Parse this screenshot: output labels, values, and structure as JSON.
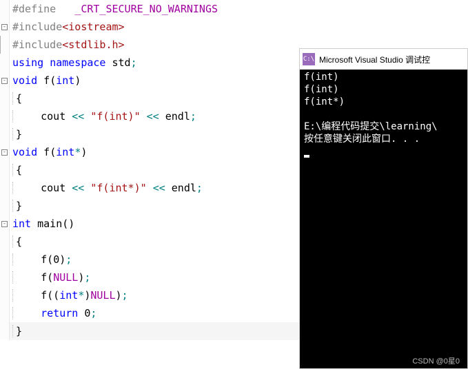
{
  "editor": {
    "lines": [
      {
        "fold": null,
        "segments": [
          {
            "t": "#define   ",
            "c": "preproc"
          },
          {
            "t": "_CRT_SECURE_NO_WARNINGS",
            "c": "preproc-def"
          }
        ]
      },
      {
        "fold": "-",
        "segments": [
          {
            "t": "#include",
            "c": "preproc"
          },
          {
            "t": "<iostream>",
            "c": "string"
          }
        ]
      },
      {
        "fold": "",
        "segments": [
          {
            "t": "#include",
            "c": "preproc"
          },
          {
            "t": "<stdlib.h>",
            "c": "string"
          }
        ]
      },
      {
        "fold": null,
        "segments": [
          {
            "t": "using",
            "c": "keyword"
          },
          {
            "t": " ",
            "c": "ident"
          },
          {
            "t": "namespace",
            "c": "keyword"
          },
          {
            "t": " std",
            "c": "ident"
          },
          {
            "t": ";",
            "c": "op"
          }
        ]
      },
      {
        "fold": "-",
        "segments": [
          {
            "t": "void",
            "c": "type"
          },
          {
            "t": " f",
            "c": "ident"
          },
          {
            "t": "(",
            "c": "bracket"
          },
          {
            "t": "int",
            "c": "type"
          },
          {
            "t": ")",
            "c": "bracket"
          }
        ]
      },
      {
        "fold": null,
        "indent": true,
        "segments": [
          {
            "t": "{",
            "c": "bracket"
          }
        ]
      },
      {
        "fold": null,
        "indent": true,
        "segments": [
          {
            "t": "    cout ",
            "c": "ident"
          },
          {
            "t": "<<",
            "c": "op"
          },
          {
            "t": " ",
            "c": "ident"
          },
          {
            "t": "\"f(int)\"",
            "c": "string"
          },
          {
            "t": " ",
            "c": "ident"
          },
          {
            "t": "<<",
            "c": "op"
          },
          {
            "t": " endl",
            "c": "ident"
          },
          {
            "t": ";",
            "c": "op"
          }
        ]
      },
      {
        "fold": null,
        "indent": true,
        "segments": [
          {
            "t": "}",
            "c": "bracket"
          }
        ]
      },
      {
        "fold": "-",
        "segments": [
          {
            "t": "void",
            "c": "type"
          },
          {
            "t": " f",
            "c": "ident"
          },
          {
            "t": "(",
            "c": "bracket"
          },
          {
            "t": "int",
            "c": "type"
          },
          {
            "t": "*",
            "c": "op"
          },
          {
            "t": ")",
            "c": "bracket"
          }
        ]
      },
      {
        "fold": null,
        "indent": true,
        "segments": [
          {
            "t": "{",
            "c": "bracket"
          }
        ]
      },
      {
        "fold": null,
        "indent": true,
        "segments": [
          {
            "t": "    cout ",
            "c": "ident"
          },
          {
            "t": "<<",
            "c": "op"
          },
          {
            "t": " ",
            "c": "ident"
          },
          {
            "t": "\"f(int*)\"",
            "c": "string"
          },
          {
            "t": " ",
            "c": "ident"
          },
          {
            "t": "<<",
            "c": "op"
          },
          {
            "t": " endl",
            "c": "ident"
          },
          {
            "t": ";",
            "c": "op"
          }
        ]
      },
      {
        "fold": null,
        "indent": true,
        "segments": [
          {
            "t": "}",
            "c": "bracket"
          }
        ]
      },
      {
        "fold": "-",
        "segments": [
          {
            "t": "int",
            "c": "type"
          },
          {
            "t": " main",
            "c": "ident"
          },
          {
            "t": "()",
            "c": "bracket"
          }
        ]
      },
      {
        "fold": null,
        "indent": true,
        "segments": [
          {
            "t": "{",
            "c": "bracket"
          }
        ]
      },
      {
        "fold": null,
        "indent": true,
        "segments": [
          {
            "t": "    f",
            "c": "ident"
          },
          {
            "t": "(",
            "c": "bracket"
          },
          {
            "t": "0",
            "c": "ident"
          },
          {
            "t": ")",
            "c": "bracket"
          },
          {
            "t": ";",
            "c": "op"
          }
        ]
      },
      {
        "fold": null,
        "indent": true,
        "segments": [
          {
            "t": "    f",
            "c": "ident"
          },
          {
            "t": "(",
            "c": "bracket"
          },
          {
            "t": "NULL",
            "c": "preproc-def"
          },
          {
            "t": ")",
            "c": "bracket"
          },
          {
            "t": ";",
            "c": "op"
          }
        ]
      },
      {
        "fold": null,
        "indent": true,
        "segments": [
          {
            "t": "    f",
            "c": "ident"
          },
          {
            "t": "((",
            "c": "bracket"
          },
          {
            "t": "int",
            "c": "type"
          },
          {
            "t": "*",
            "c": "op"
          },
          {
            "t": ")",
            "c": "bracket"
          },
          {
            "t": "NULL",
            "c": "preproc-def"
          },
          {
            "t": ")",
            "c": "bracket"
          },
          {
            "t": ";",
            "c": "op"
          }
        ]
      },
      {
        "fold": null,
        "indent": true,
        "segments": [
          {
            "t": "    ",
            "c": "ident"
          },
          {
            "t": "return",
            "c": "keyword"
          },
          {
            "t": " ",
            "c": "ident"
          },
          {
            "t": "0",
            "c": "ident"
          },
          {
            "t": ";",
            "c": "op"
          }
        ]
      },
      {
        "fold": null,
        "indent": true,
        "cursor": true,
        "segments": [
          {
            "t": "}",
            "c": "bracket"
          }
        ]
      }
    ]
  },
  "console": {
    "icon": "C:\\",
    "title": "Microsoft Visual Studio 调试控",
    "lines": [
      "f(int)",
      "f(int)",
      "f(int*)",
      "",
      "E:\\编程代码提交\\learning\\",
      "按任意键关闭此窗口. . ."
    ]
  },
  "watermark": "CSDN @0星0"
}
